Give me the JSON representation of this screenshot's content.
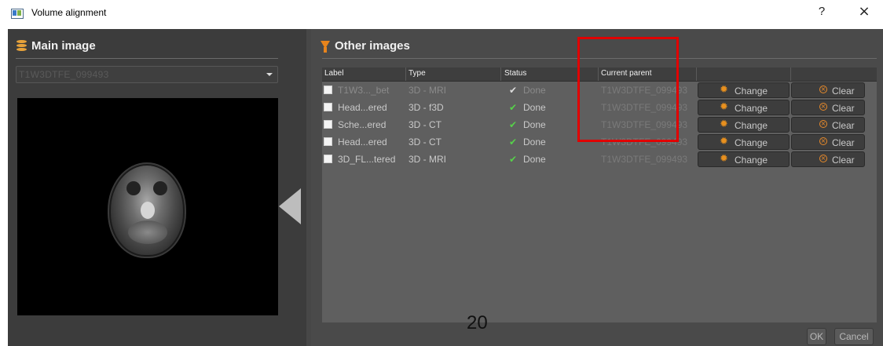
{
  "window": {
    "title": "Volume alignment",
    "help_glyph": "?",
    "close_glyph": "×"
  },
  "main_image": {
    "heading": "Main image",
    "selected": "T1W3DTFE_099493"
  },
  "other_images": {
    "heading": "Other images",
    "columns": [
      "Label",
      "Type",
      "Status",
      "Current parent"
    ],
    "rows": [
      {
        "label": "T1W3..._bet",
        "type": "3D - MRI",
        "status": "Done",
        "parent": "T1W3DTFE_099493",
        "change": "Change",
        "clear": "Clear"
      },
      {
        "label": "Head...ered",
        "type": "3D - f3D",
        "status": "Done",
        "parent": "T1W3DTFE_099493",
        "change": "Change",
        "clear": "Clear"
      },
      {
        "label": "Sche...ered",
        "type": "3D - CT",
        "status": "Done",
        "parent": "T1W3DTFE_099493",
        "change": "Change",
        "clear": "Clear"
      },
      {
        "label": "Head...ered",
        "type": "3D - CT",
        "status": "Done",
        "parent": "T1W3DTFE_099493",
        "change": "Change",
        "clear": "Clear"
      },
      {
        "label": "3D_FL...tered",
        "type": "3D - MRI",
        "status": "Done",
        "parent": "T1W3DTFE_099493",
        "change": "Change",
        "clear": "Clear"
      }
    ]
  },
  "footer": {
    "ok": "OK",
    "cancel": "Cancel"
  },
  "page_number": "20",
  "colors": {
    "accent_orange": "#e8841c",
    "done_green": "#56d14a",
    "highlight_red": "#e10000"
  }
}
